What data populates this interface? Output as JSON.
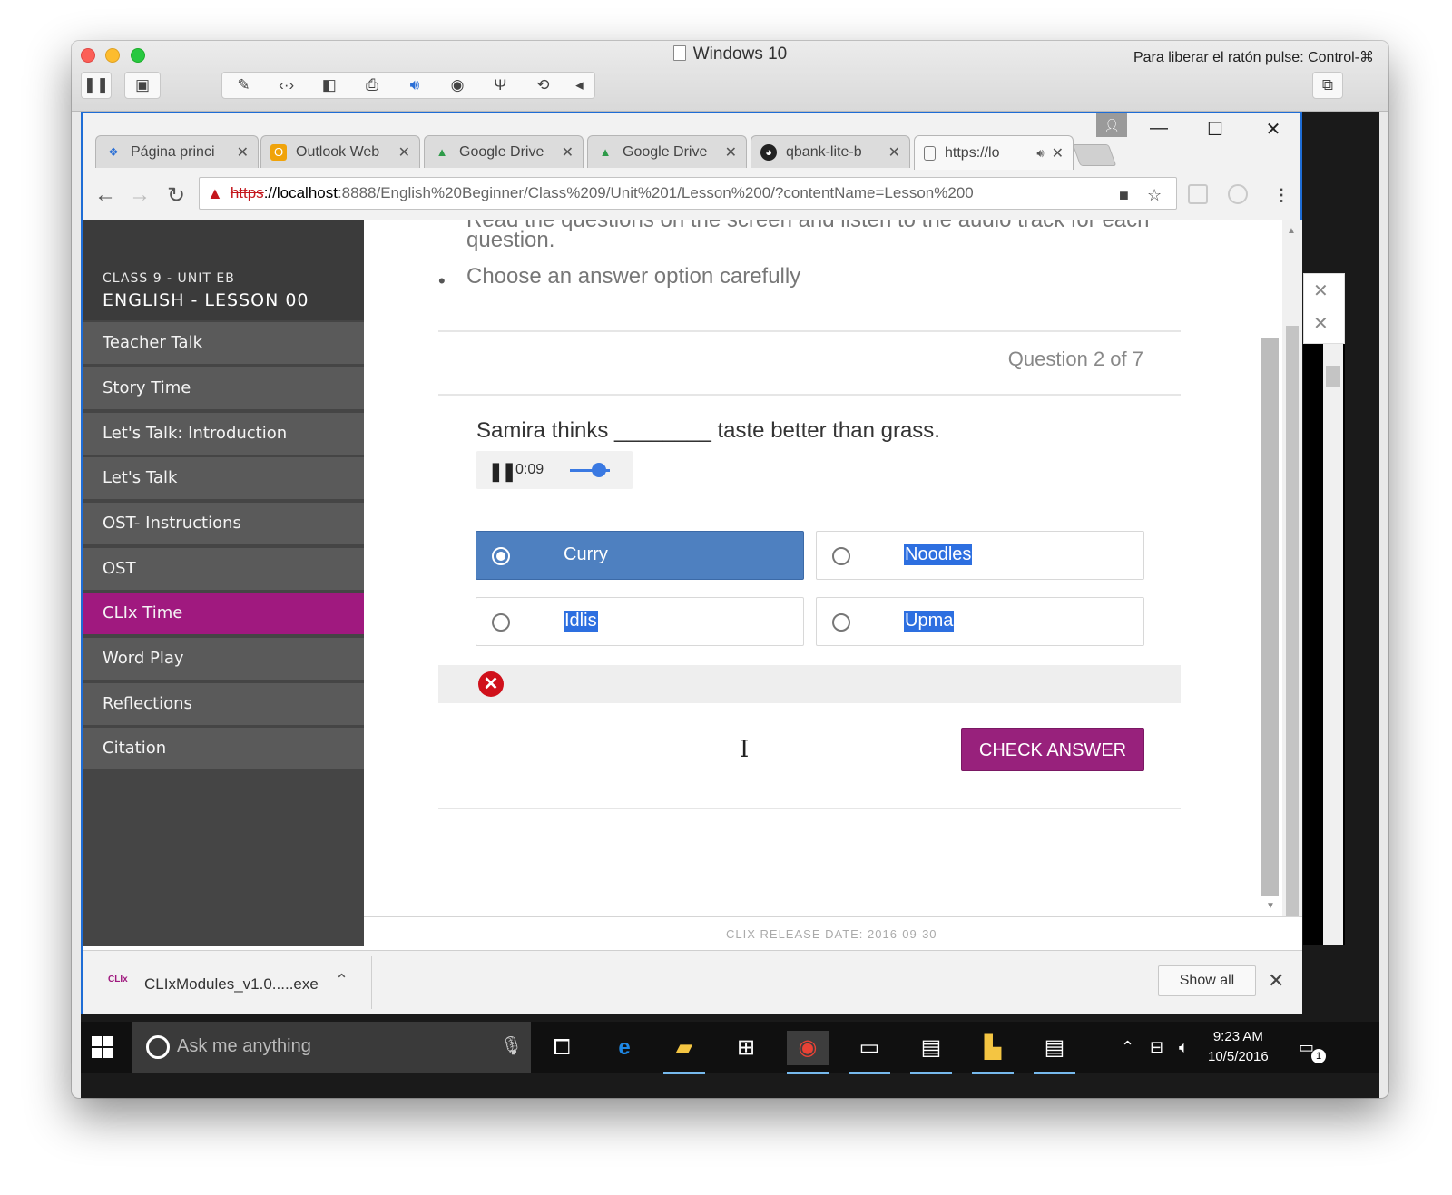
{
  "vm": {
    "title": "Windows 10",
    "release_hint": "Para liberar el ratón pulse: Control-⌘"
  },
  "browser": {
    "tabs": [
      {
        "label": "Página princi",
        "icon": "dropbox-icon"
      },
      {
        "label": "Outlook Web",
        "icon": "outlook-icon"
      },
      {
        "label": "Google Drive",
        "icon": "google-drive-icon"
      },
      {
        "label": "Google Drive",
        "icon": "google-drive-icon"
      },
      {
        "label": "qbank-lite-b",
        "icon": "github-icon"
      },
      {
        "label": "https://lo",
        "icon": "page-icon"
      }
    ],
    "url": {
      "scheme": "https",
      "rest": "://localhost",
      "path": ":8888/English%20Beginner/Class%209/Unit%201/Lesson%200/?contentName=Lesson%200"
    }
  },
  "sidebar": {
    "kicker": "CLASS 9 - UNIT EB",
    "title": "ENGLISH - LESSON 00",
    "items": [
      {
        "label": "Teacher Talk"
      },
      {
        "label": "Story Time"
      },
      {
        "label": "Let's Talk: Introduction"
      },
      {
        "label": "Let's Talk"
      },
      {
        "label": "OST- Instructions"
      },
      {
        "label": "OST"
      },
      {
        "label": "CLIx Time"
      },
      {
        "label": "Word Play"
      },
      {
        "label": "Reflections"
      },
      {
        "label": "Citation"
      }
    ],
    "active_index": 6
  },
  "content": {
    "instruction_cut": "Read the questions on the screen and listen to the audio track for each",
    "instruction_cont": "question.",
    "instruction_2": "Choose an answer option carefully",
    "question_counter": "Question 2 of 7",
    "question": "Samira thinks ________ taste better than grass.",
    "audio_time": "0:09",
    "options": [
      {
        "label": "Curry",
        "selected": true
      },
      {
        "label": "Noodles",
        "selected": false
      },
      {
        "label": "Idlis",
        "selected": false
      },
      {
        "label": "Upma",
        "selected": false
      }
    ],
    "check_button": "CHECK ANSWER",
    "footer": "CLIX RELEASE DATE: 2016-09-30"
  },
  "downloads": {
    "file": "CLIxModules_v1.0.....exe",
    "icon_text": "CLIx",
    "show_all": "Show all"
  },
  "taskbar": {
    "search_placeholder": "Ask me anything",
    "time": "9:23 AM",
    "date": "10/5/2016",
    "notification_count": "1"
  },
  "colors": {
    "accent": "#a0197f",
    "selected_option": "#4e80c0",
    "check_button": "#98217c",
    "error": "#d0111b"
  }
}
